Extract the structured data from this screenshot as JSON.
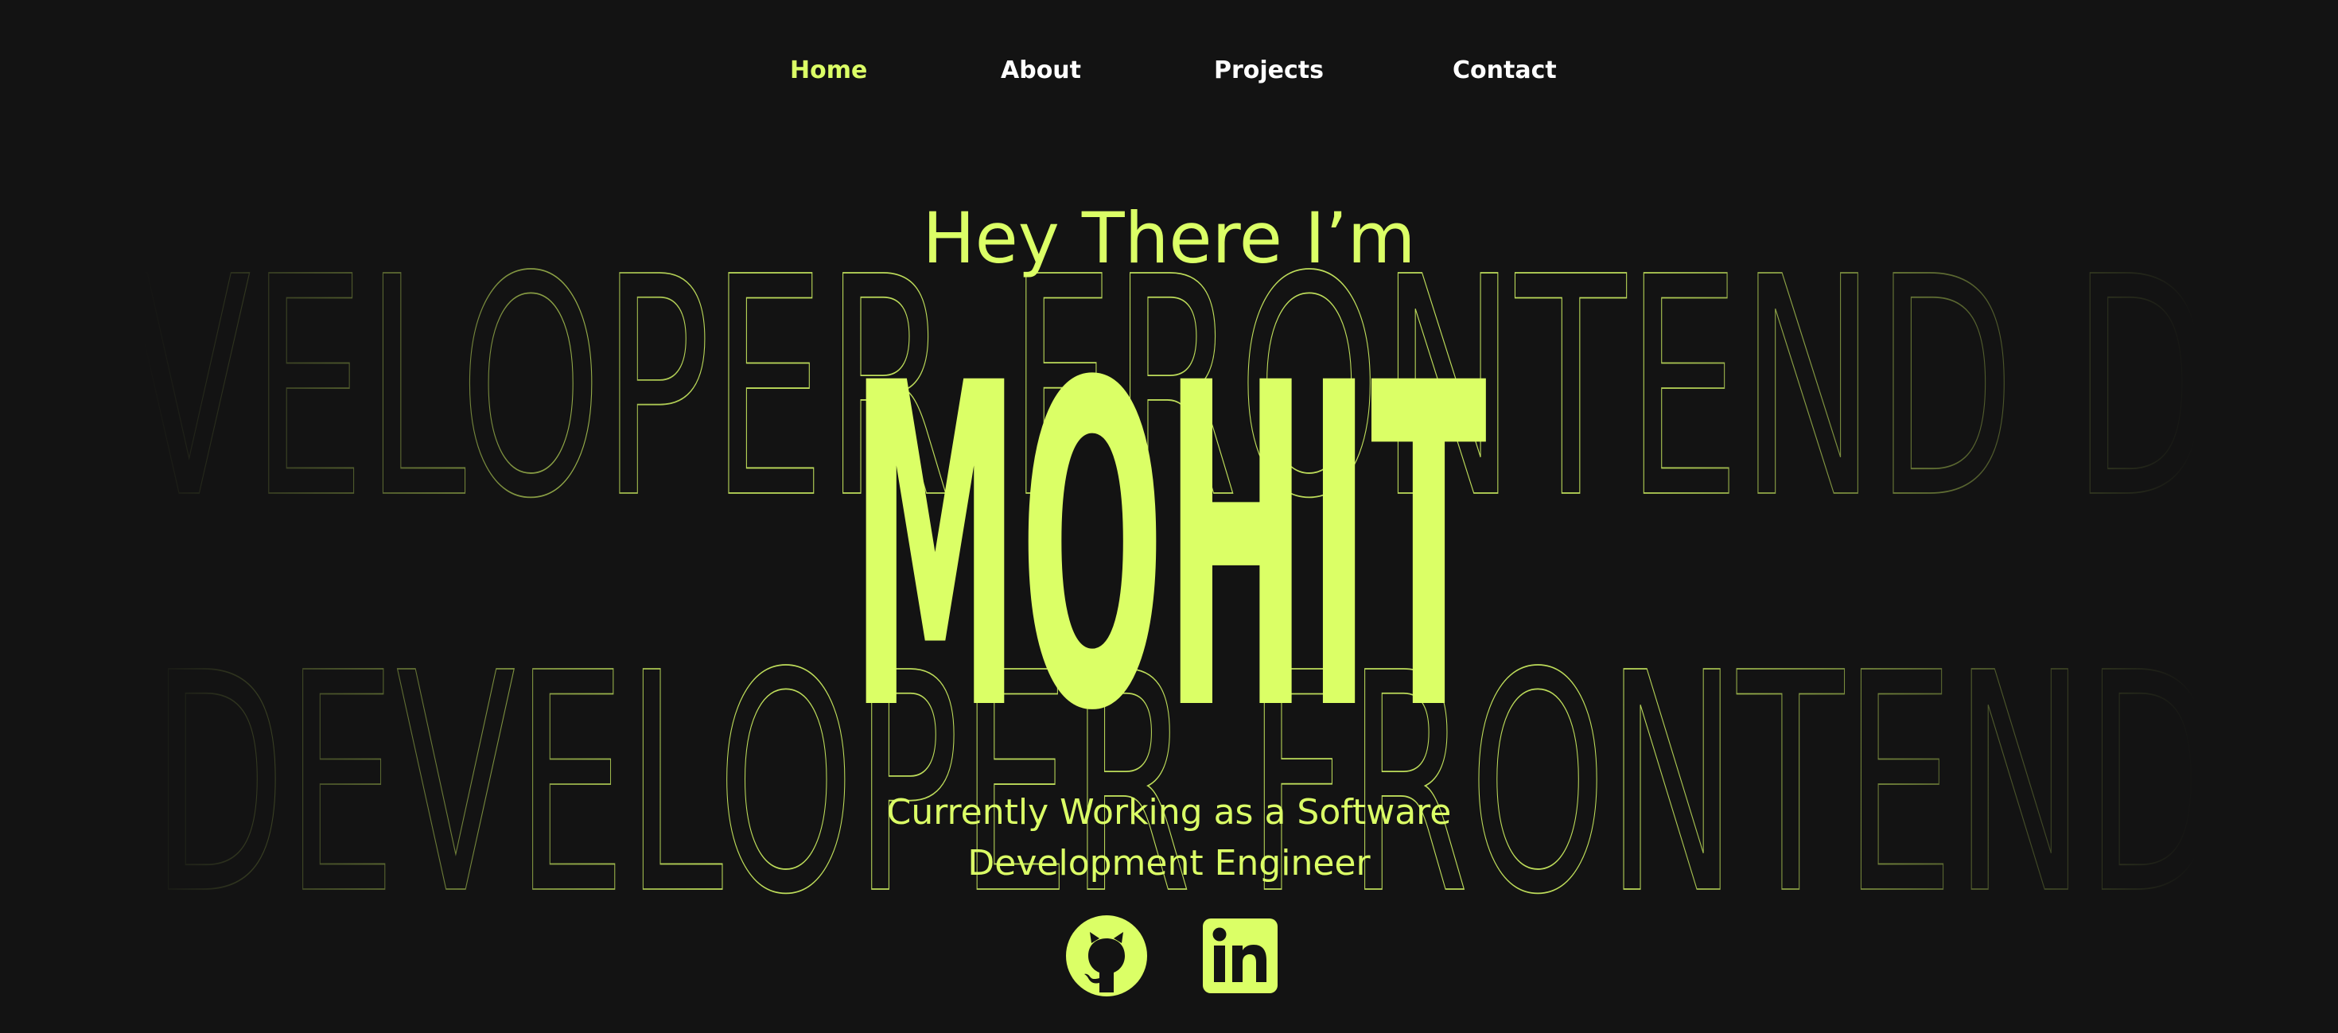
{
  "nav": {
    "items": [
      {
        "label": "Home",
        "active": true
      },
      {
        "label": "About",
        "active": false
      },
      {
        "label": "Projects",
        "active": false
      },
      {
        "label": "Contact",
        "active": false
      }
    ]
  },
  "hero": {
    "greeting": "Hey There I’m",
    "name": "MOHIT",
    "subtitle_line1": "Currently Working as a Software",
    "subtitle_line2": "Development Engineer",
    "background_row1": "VELOPER FRONTEND D",
    "background_row2": "DEVELOPER FRONTEND"
  },
  "social": {
    "github_icon": "github-icon",
    "linkedin_icon": "linkedin-icon"
  },
  "colors": {
    "background": "#131313",
    "accent": "#dbff66",
    "nav_text": "#ffffff"
  }
}
